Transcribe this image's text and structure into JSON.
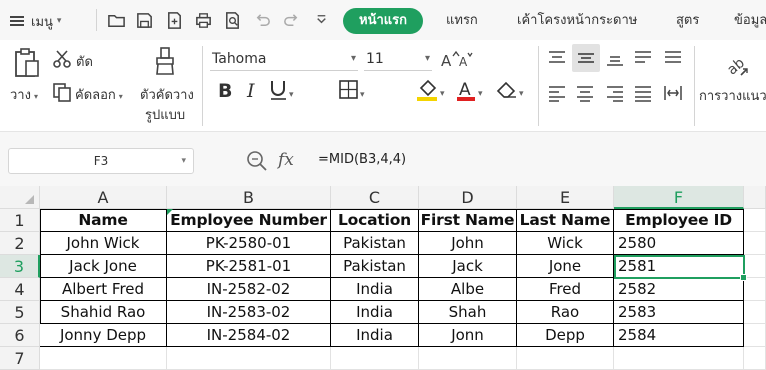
{
  "menu": {
    "menu_label": "เมนู",
    "tabs": [
      "หน้าแรก",
      "แทรก",
      "เค้าโครงหน้ากระดาษ",
      "สูตร",
      "ข้อมูล"
    ],
    "active_tab": "หน้าแรก",
    "accent_color": "#1f9f5f"
  },
  "ribbon": {
    "cut_label": "ตัด",
    "copy_label": "คัดลอก",
    "paste_label": "วาง",
    "format_painter_label_line1": "ตัวคัดวาง",
    "format_painter_label_line2": "รูปแบบ",
    "font_name": "Tahoma",
    "font_size": "11",
    "wrap_label": "การวางแนว",
    "icons": [
      "paste-icon",
      "cut-icon",
      "copy-icon",
      "format-painter-icon",
      "bold-icon",
      "italic-icon",
      "underline-icon",
      "borders-icon",
      "fill-color-icon",
      "font-color-icon",
      "clear-icon",
      "align-top-icon",
      "align-middle-icon",
      "align-bottom-icon",
      "align-left-icon",
      "align-center-icon",
      "align-right-icon",
      "justify-icon",
      "distributed-icon",
      "orientation-icon"
    ]
  },
  "formula_bar": {
    "name_box": "F3",
    "fx_label": "fx",
    "formula": "=MID(B3,4,4)"
  },
  "sheet": {
    "columns": [
      "A",
      "B",
      "C",
      "D",
      "E",
      "F"
    ],
    "selected_column": "F",
    "rows": [
      "1",
      "2",
      "3",
      "4",
      "5",
      "6",
      "7"
    ],
    "selected_row": "3",
    "header": [
      "Name",
      "Employee Number",
      "Location",
      "First Name",
      "Last Name",
      "Employee ID"
    ],
    "data": [
      [
        "John Wick",
        "PK-2580-01",
        "Pakistan",
        "John",
        "Wick",
        "2580"
      ],
      [
        "Jack Jone",
        "PK-2581-01",
        "Pakistan",
        "Jack",
        "Jone",
        "2581"
      ],
      [
        "Albert Fred",
        "IN-2582-02",
        "India",
        "Albe",
        "Fred",
        "2582"
      ],
      [
        "Shahid Rao",
        "IN-2583-02",
        "India",
        "Shah",
        "Rao",
        "2583"
      ],
      [
        "Jonny Depp",
        "IN-2584-02",
        "India",
        "Jonn",
        "Depp",
        "2584"
      ]
    ],
    "active_cell": "F3"
  }
}
